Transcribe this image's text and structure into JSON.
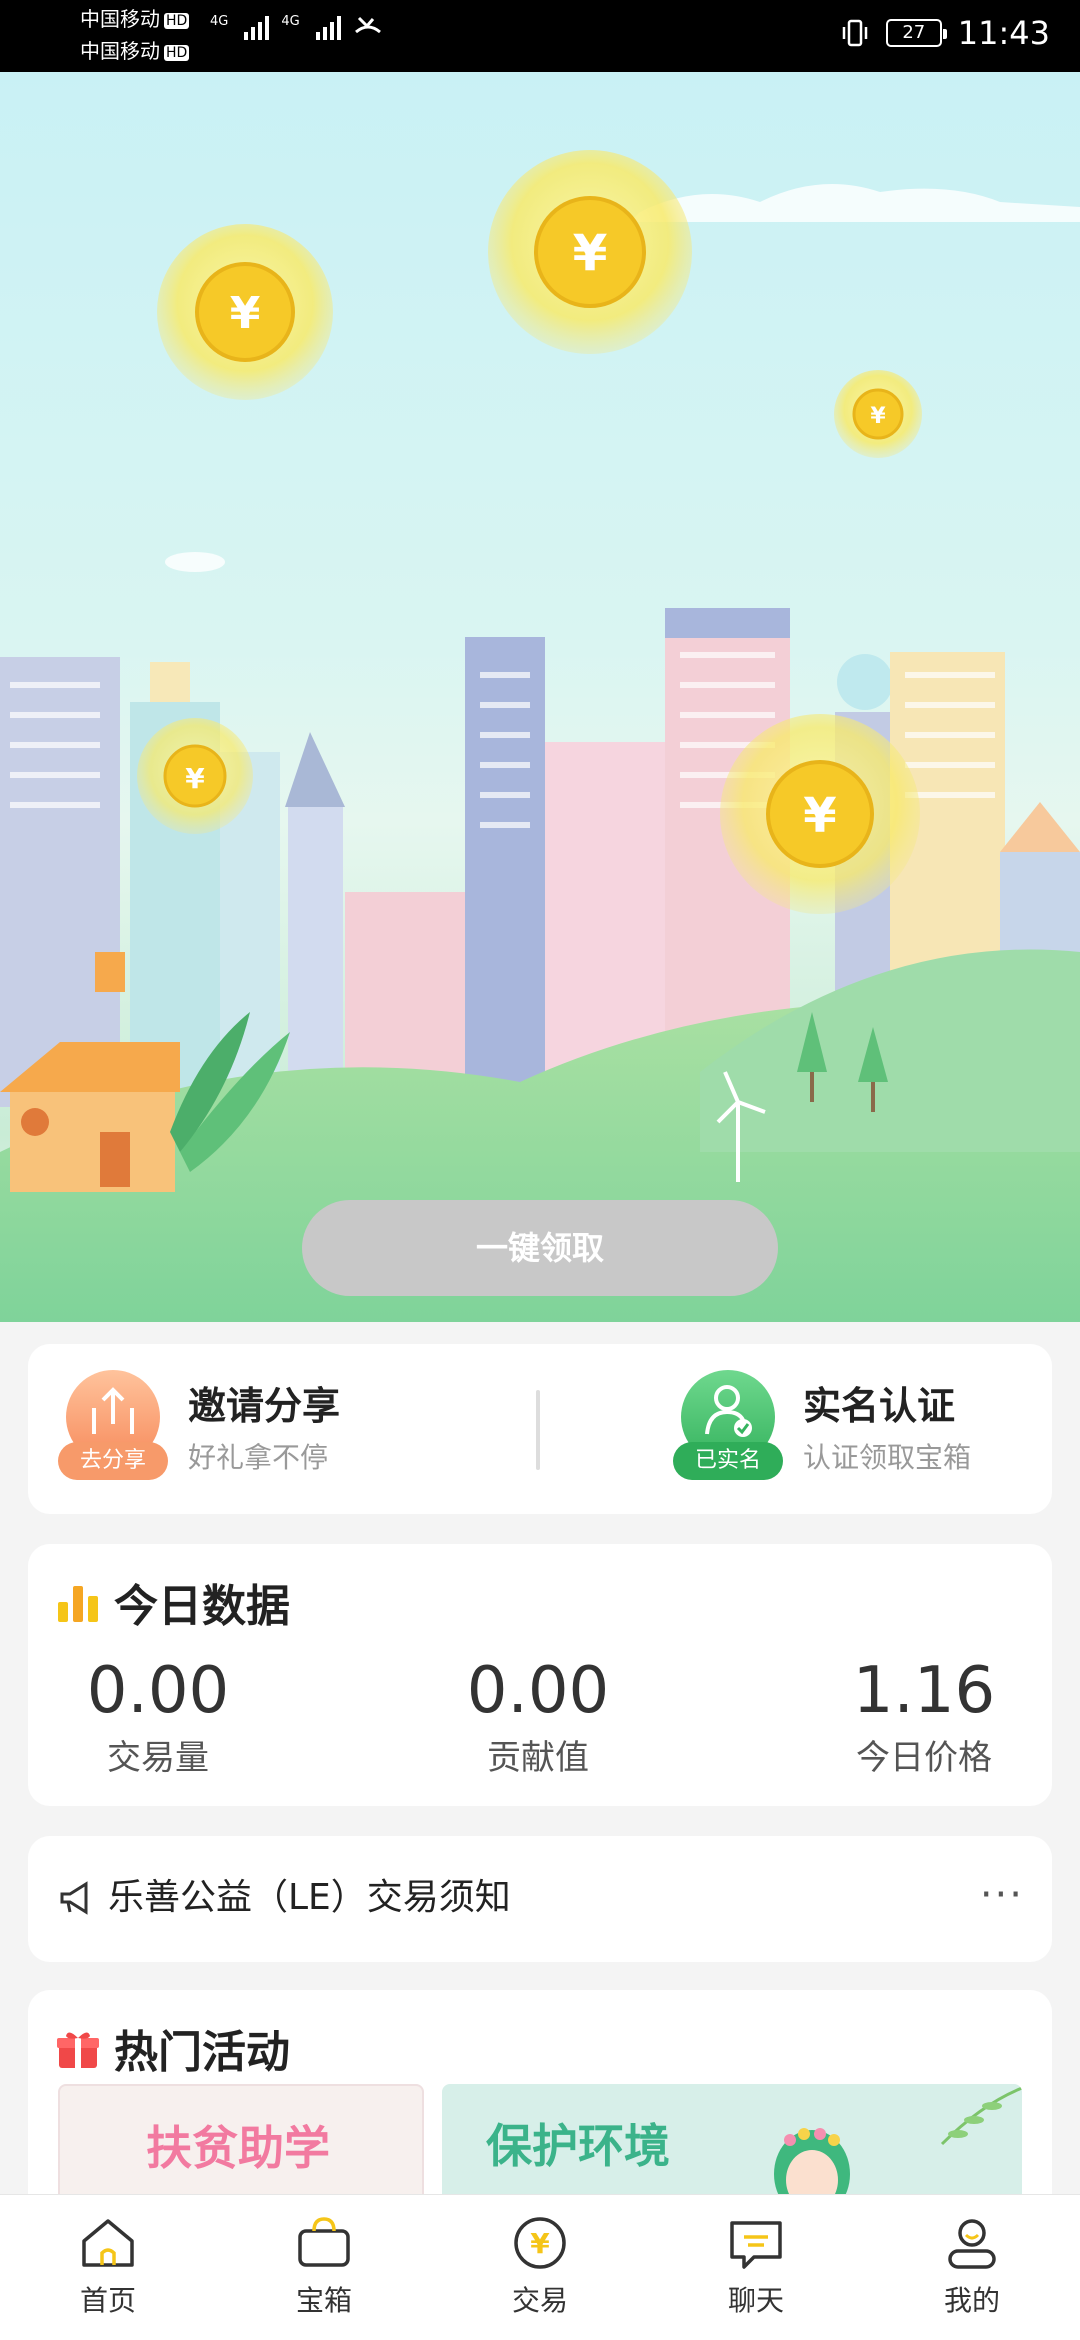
{
  "status_bar": {
    "carrier1": "中国移动",
    "carrier2": "中国移动",
    "hd": "HD",
    "network1": "4G",
    "network2": "4G",
    "battery": "27",
    "time": "11:43"
  },
  "hero": {
    "claim_button": "一键领取"
  },
  "features": {
    "invite": {
      "title": "邀请分享",
      "subtitle": "好礼拿不停",
      "tag": "去分享"
    },
    "verify": {
      "title": "实名认证",
      "subtitle": "认证领取宝箱",
      "tag": "已实名"
    }
  },
  "today_data": {
    "title": "今日数据",
    "stats": [
      {
        "value": "0.00",
        "label": "交易量"
      },
      {
        "value": "0.00",
        "label": "贡献值"
      },
      {
        "value": "1.16",
        "label": "今日价格"
      }
    ]
  },
  "notice": {
    "text": "乐善公益（LE）交易须知",
    "more": "···"
  },
  "activities": {
    "title": "热门活动",
    "banners": [
      "扶贫助学",
      "保护环境"
    ]
  },
  "tabbar": {
    "items": [
      {
        "label": "首页",
        "icon": "home-icon"
      },
      {
        "label": "宝箱",
        "icon": "treasure-box-icon"
      },
      {
        "label": "交易",
        "icon": "yuan-coin-icon"
      },
      {
        "label": "聊天",
        "icon": "chat-icon"
      },
      {
        "label": "我的",
        "icon": "profile-icon"
      }
    ]
  },
  "colors": {
    "accent": "#f5c518",
    "invite_orange": "#f79a6a",
    "verify_green": "#3dbd6a",
    "claim_disabled": "#c8c8c8"
  }
}
